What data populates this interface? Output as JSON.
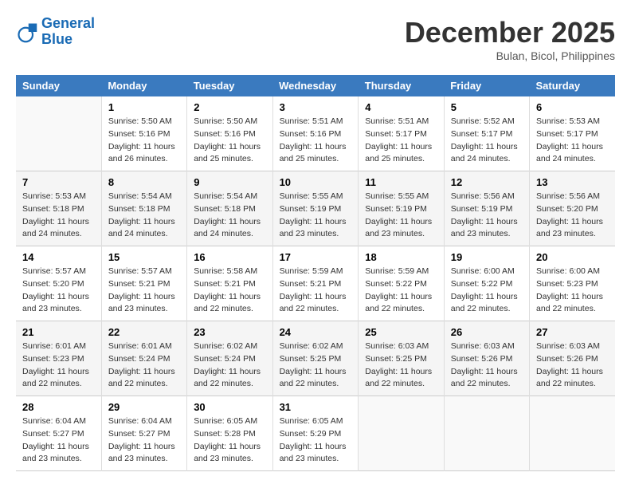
{
  "logo": {
    "line1": "General",
    "line2": "Blue"
  },
  "title": "December 2025",
  "location": "Bulan, Bicol, Philippines",
  "days_of_week": [
    "Sunday",
    "Monday",
    "Tuesday",
    "Wednesday",
    "Thursday",
    "Friday",
    "Saturday"
  ],
  "weeks": [
    [
      {
        "num": "",
        "sunrise": "",
        "sunset": "",
        "daylight": ""
      },
      {
        "num": "1",
        "sunrise": "Sunrise: 5:50 AM",
        "sunset": "Sunset: 5:16 PM",
        "daylight": "Daylight: 11 hours and 26 minutes."
      },
      {
        "num": "2",
        "sunrise": "Sunrise: 5:50 AM",
        "sunset": "Sunset: 5:16 PM",
        "daylight": "Daylight: 11 hours and 25 minutes."
      },
      {
        "num": "3",
        "sunrise": "Sunrise: 5:51 AM",
        "sunset": "Sunset: 5:16 PM",
        "daylight": "Daylight: 11 hours and 25 minutes."
      },
      {
        "num": "4",
        "sunrise": "Sunrise: 5:51 AM",
        "sunset": "Sunset: 5:17 PM",
        "daylight": "Daylight: 11 hours and 25 minutes."
      },
      {
        "num": "5",
        "sunrise": "Sunrise: 5:52 AM",
        "sunset": "Sunset: 5:17 PM",
        "daylight": "Daylight: 11 hours and 24 minutes."
      },
      {
        "num": "6",
        "sunrise": "Sunrise: 5:53 AM",
        "sunset": "Sunset: 5:17 PM",
        "daylight": "Daylight: 11 hours and 24 minutes."
      }
    ],
    [
      {
        "num": "7",
        "sunrise": "Sunrise: 5:53 AM",
        "sunset": "Sunset: 5:18 PM",
        "daylight": "Daylight: 11 hours and 24 minutes."
      },
      {
        "num": "8",
        "sunrise": "Sunrise: 5:54 AM",
        "sunset": "Sunset: 5:18 PM",
        "daylight": "Daylight: 11 hours and 24 minutes."
      },
      {
        "num": "9",
        "sunrise": "Sunrise: 5:54 AM",
        "sunset": "Sunset: 5:18 PM",
        "daylight": "Daylight: 11 hours and 24 minutes."
      },
      {
        "num": "10",
        "sunrise": "Sunrise: 5:55 AM",
        "sunset": "Sunset: 5:19 PM",
        "daylight": "Daylight: 11 hours and 23 minutes."
      },
      {
        "num": "11",
        "sunrise": "Sunrise: 5:55 AM",
        "sunset": "Sunset: 5:19 PM",
        "daylight": "Daylight: 11 hours and 23 minutes."
      },
      {
        "num": "12",
        "sunrise": "Sunrise: 5:56 AM",
        "sunset": "Sunset: 5:19 PM",
        "daylight": "Daylight: 11 hours and 23 minutes."
      },
      {
        "num": "13",
        "sunrise": "Sunrise: 5:56 AM",
        "sunset": "Sunset: 5:20 PM",
        "daylight": "Daylight: 11 hours and 23 minutes."
      }
    ],
    [
      {
        "num": "14",
        "sunrise": "Sunrise: 5:57 AM",
        "sunset": "Sunset: 5:20 PM",
        "daylight": "Daylight: 11 hours and 23 minutes."
      },
      {
        "num": "15",
        "sunrise": "Sunrise: 5:57 AM",
        "sunset": "Sunset: 5:21 PM",
        "daylight": "Daylight: 11 hours and 23 minutes."
      },
      {
        "num": "16",
        "sunrise": "Sunrise: 5:58 AM",
        "sunset": "Sunset: 5:21 PM",
        "daylight": "Daylight: 11 hours and 22 minutes."
      },
      {
        "num": "17",
        "sunrise": "Sunrise: 5:59 AM",
        "sunset": "Sunset: 5:21 PM",
        "daylight": "Daylight: 11 hours and 22 minutes."
      },
      {
        "num": "18",
        "sunrise": "Sunrise: 5:59 AM",
        "sunset": "Sunset: 5:22 PM",
        "daylight": "Daylight: 11 hours and 22 minutes."
      },
      {
        "num": "19",
        "sunrise": "Sunrise: 6:00 AM",
        "sunset": "Sunset: 5:22 PM",
        "daylight": "Daylight: 11 hours and 22 minutes."
      },
      {
        "num": "20",
        "sunrise": "Sunrise: 6:00 AM",
        "sunset": "Sunset: 5:23 PM",
        "daylight": "Daylight: 11 hours and 22 minutes."
      }
    ],
    [
      {
        "num": "21",
        "sunrise": "Sunrise: 6:01 AM",
        "sunset": "Sunset: 5:23 PM",
        "daylight": "Daylight: 11 hours and 22 minutes."
      },
      {
        "num": "22",
        "sunrise": "Sunrise: 6:01 AM",
        "sunset": "Sunset: 5:24 PM",
        "daylight": "Daylight: 11 hours and 22 minutes."
      },
      {
        "num": "23",
        "sunrise": "Sunrise: 6:02 AM",
        "sunset": "Sunset: 5:24 PM",
        "daylight": "Daylight: 11 hours and 22 minutes."
      },
      {
        "num": "24",
        "sunrise": "Sunrise: 6:02 AM",
        "sunset": "Sunset: 5:25 PM",
        "daylight": "Daylight: 11 hours and 22 minutes."
      },
      {
        "num": "25",
        "sunrise": "Sunrise: 6:03 AM",
        "sunset": "Sunset: 5:25 PM",
        "daylight": "Daylight: 11 hours and 22 minutes."
      },
      {
        "num": "26",
        "sunrise": "Sunrise: 6:03 AM",
        "sunset": "Sunset: 5:26 PM",
        "daylight": "Daylight: 11 hours and 22 minutes."
      },
      {
        "num": "27",
        "sunrise": "Sunrise: 6:03 AM",
        "sunset": "Sunset: 5:26 PM",
        "daylight": "Daylight: 11 hours and 22 minutes."
      }
    ],
    [
      {
        "num": "28",
        "sunrise": "Sunrise: 6:04 AM",
        "sunset": "Sunset: 5:27 PM",
        "daylight": "Daylight: 11 hours and 23 minutes."
      },
      {
        "num": "29",
        "sunrise": "Sunrise: 6:04 AM",
        "sunset": "Sunset: 5:27 PM",
        "daylight": "Daylight: 11 hours and 23 minutes."
      },
      {
        "num": "30",
        "sunrise": "Sunrise: 6:05 AM",
        "sunset": "Sunset: 5:28 PM",
        "daylight": "Daylight: 11 hours and 23 minutes."
      },
      {
        "num": "31",
        "sunrise": "Sunrise: 6:05 AM",
        "sunset": "Sunset: 5:29 PM",
        "daylight": "Daylight: 11 hours and 23 minutes."
      },
      {
        "num": "",
        "sunrise": "",
        "sunset": "",
        "daylight": ""
      },
      {
        "num": "",
        "sunrise": "",
        "sunset": "",
        "daylight": ""
      },
      {
        "num": "",
        "sunrise": "",
        "sunset": "",
        "daylight": ""
      }
    ]
  ]
}
